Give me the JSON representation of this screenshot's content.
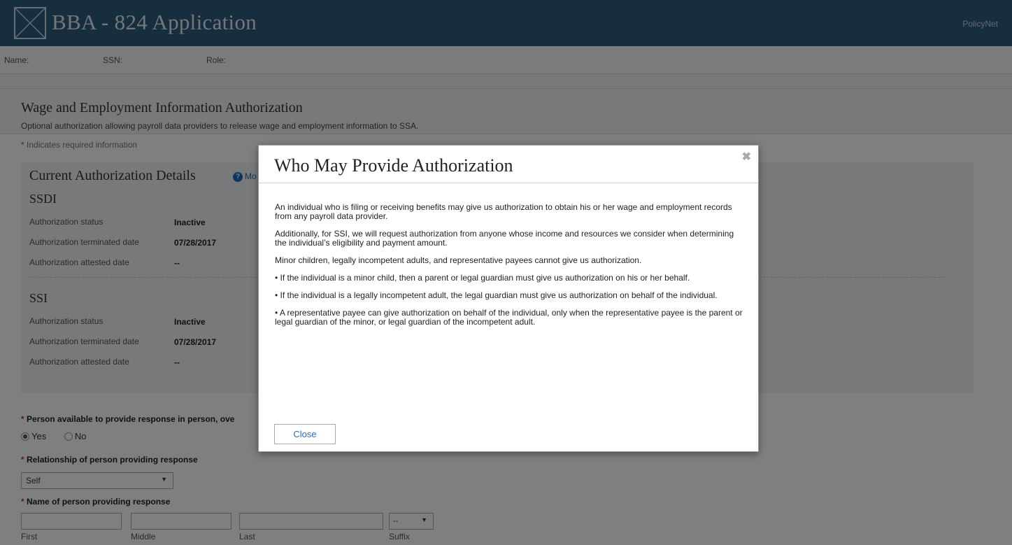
{
  "header": {
    "app_title": "BBA - 824 Application",
    "policynet": "PolicyNet"
  },
  "infobar": {
    "name_label": "Name:",
    "ssn_label": "SSN:",
    "role_label": "Role:"
  },
  "section": {
    "title": "Wage and Employment Information Authorization",
    "subtitle": "Optional authorization allowing payroll data providers to release wage and employment information to SSA.",
    "required_note": "Indicates required information"
  },
  "details": {
    "title": "Current Authorization Details",
    "more_info": "Mo",
    "ssdi": {
      "title": "SSDI",
      "rows": [
        {
          "label": "Authorization status",
          "value": "Inactive"
        },
        {
          "label": "Authorization terminated date",
          "value": "07/28/2017"
        },
        {
          "label": "Authorization attested date",
          "value": "--"
        }
      ]
    },
    "ssi": {
      "title": "SSI",
      "rows": [
        {
          "label": "Authorization status",
          "value": "Inactive"
        },
        {
          "label": "Authorization terminated date",
          "value": "07/28/2017"
        },
        {
          "label": "Authorization attested date",
          "value": "--"
        }
      ]
    }
  },
  "form": {
    "person_available_label": "Person available to provide response in person, ove",
    "radio_yes": "Yes",
    "radio_no": "No",
    "relationship_label": "Relationship of person providing response",
    "relationship_value": "Self",
    "name_label": "Name of person providing response",
    "first_label": "First",
    "middle_label": "Middle",
    "last_label": "Last",
    "suffix_label": "Suffix",
    "suffix_value": "--",
    "arrow": "▼"
  },
  "modal": {
    "title": "Who May Provide Authorization",
    "close_x": "✖",
    "paragraphs": [
      "An individual who is filing or receiving benefits may give us authorization to obtain his or her wage and employment records from any payroll data provider.",
      "Additionally, for SSI, we will request authorization from anyone whose income and resources we consider when determining the individual’s eligibility and payment amount.",
      "Minor children, legally incompetent adults, and representative payees cannot give us authorization.",
      "• If the individual is a minor child, then a parent or legal guardian must give us authorization on his or her behalf.",
      "• If the individual is a legally incompetent adult, the legal guardian must give us authorization on behalf of the individual.",
      "• A representative payee can give authorization on behalf of the individual, only when the representative payee is the parent or legal guardian of the minor, or legal guardian of the incompetent adult."
    ],
    "close_button": "Close"
  },
  "colors": {
    "header_bg": "#2e5d7d",
    "link": "#2a6ebb",
    "required": "#c0392b"
  }
}
